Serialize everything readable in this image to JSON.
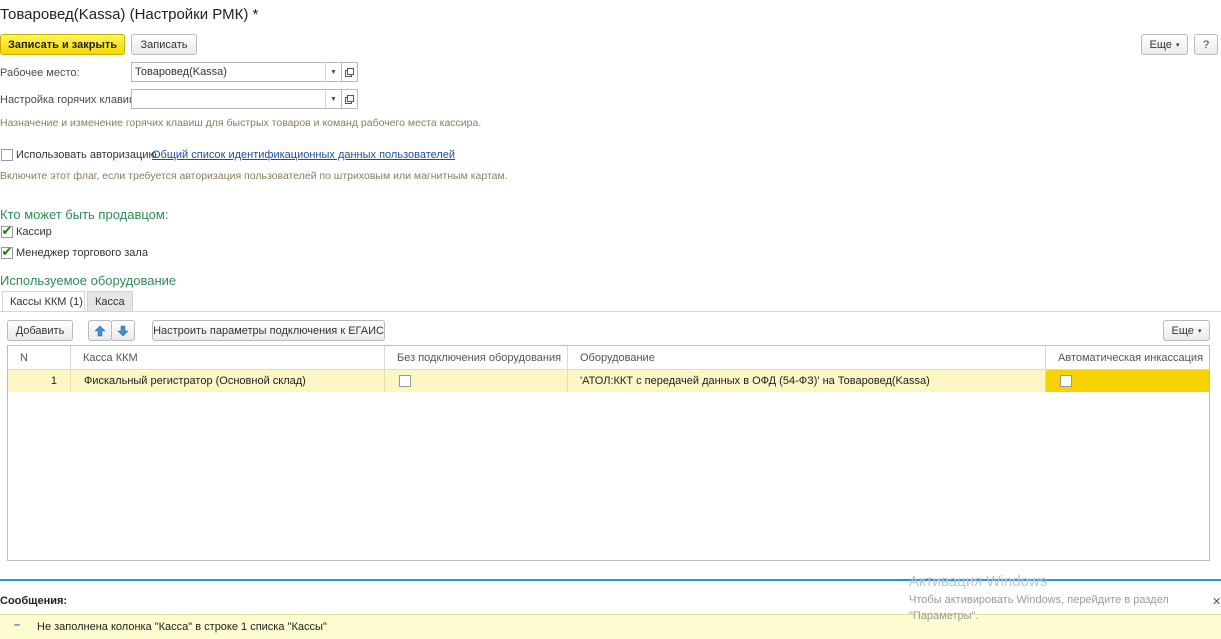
{
  "window": {
    "title": "Товаровед(Kassa) (Настройки РМК) *"
  },
  "toolbar": {
    "save_close_label": "Записать и закрыть",
    "save_label": "Записать",
    "more_label": "Еще",
    "help_label": "?"
  },
  "form": {
    "workplace_label": "Рабочее место:",
    "workplace_value": "Товаровед(Kassa)",
    "hotkeys_label": "Настройка горячих клавиш:",
    "hotkeys_value": "",
    "hotkeys_hint": "Назначение и изменение горячих клавиш для быстрых товаров и команд рабочего места кассира.",
    "use_auth_label": "Использовать авторизацию",
    "use_auth_checked": false,
    "auth_link": "Общий список идентификационных данных пользователей",
    "auth_hint": "Включите этот флаг, если требуется авторизация пользователей по штриховым или магнитным картам."
  },
  "sellers": {
    "heading": "Кто может быть продавцом:",
    "items": [
      {
        "label": "Кассир",
        "checked": true
      },
      {
        "label": "Менеджер торгового зала",
        "checked": true
      }
    ]
  },
  "equipment": {
    "heading": "Используемое оборудование",
    "tabs": [
      {
        "label": "Кассы ККМ (1)",
        "active": true
      },
      {
        "label": "Касса",
        "active": false
      }
    ],
    "add_label": "Добавить",
    "configure_label": "Настроить параметры подключения к ЕГАИС",
    "more_label": "Еще",
    "columns": [
      "N",
      "Касса ККМ",
      "Без подключения оборудования",
      "Оборудование",
      "Автоматическая инкассация"
    ],
    "rows": [
      {
        "n": "1",
        "kkm": "Фискальный регистратор (Основной склад)",
        "no_connection": false,
        "equipment": "'АТОЛ:ККТ с передачей данных в ОФД (54-ФЗ)' на Товаровед(Kassa)",
        "auto_collection": false
      }
    ]
  },
  "messages": {
    "heading": "Сообщения:",
    "items": [
      "Не заполнена колонка \"Касса\" в строке 1 списка \"Кассы\""
    ]
  },
  "watermark": {
    "line1": "Активация Windows",
    "line2": "Чтобы активировать Windows, перейдите в раздел",
    "line3": "\"Параметры\"."
  },
  "colors": {
    "primary_button": "#f5d800",
    "section_heading": "#2e8b57",
    "link": "#1a4f9c",
    "selected_row": "#fbf6c4",
    "selected_cell": "#f5d200",
    "divider": "#1d9bd8",
    "message_bar": "#fdfbd0"
  }
}
